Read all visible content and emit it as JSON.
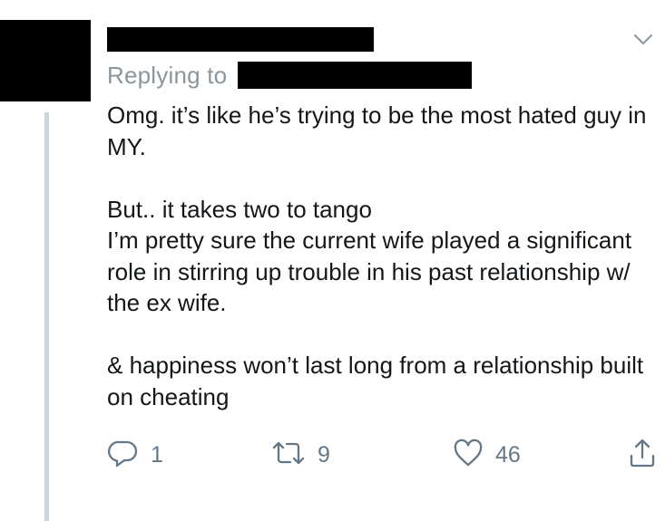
{
  "tweet": {
    "replying_label": "Replying to",
    "paragraphs": [
      "Omg. it’s like he’s trying to be the most hated guy in MY.",
      "But.. it takes two to tango",
      "I’m pretty sure the current wife played a significant role in stirring up trouble in his past relationship w/ the ex wife.",
      "& happiness won’t last long from a relationship built on cheating"
    ]
  },
  "actions": {
    "reply_count": "1",
    "retweet_count": "9",
    "like_count": "46"
  },
  "icons": {
    "caret": "chevron-down-icon",
    "reply": "reply-icon",
    "retweet": "retweet-icon",
    "like": "heart-icon",
    "share": "share-icon"
  },
  "colors": {
    "text": "#14171a",
    "secondary": "#657786",
    "thread_line": "#ccd6dd",
    "redaction": "#000000"
  }
}
